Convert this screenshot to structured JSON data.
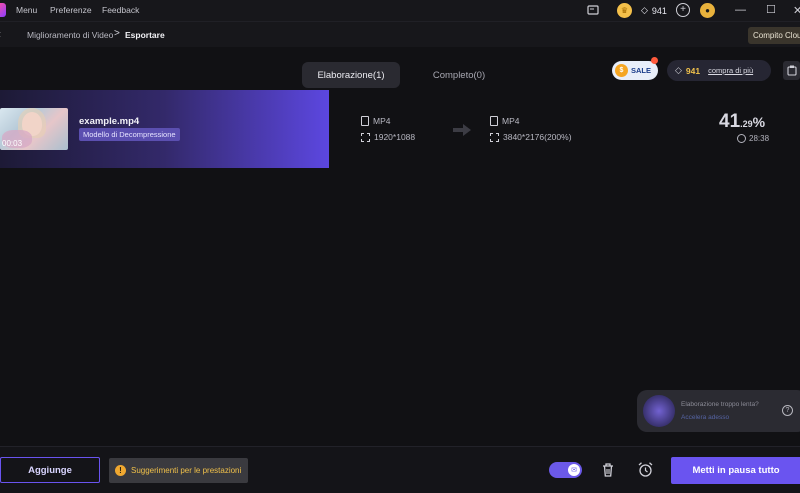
{
  "titlebar": {
    "menu": [
      "Menu",
      "Preferenze",
      "Feedback"
    ],
    "credits": "941"
  },
  "breadcrumb": {
    "parent": "Miglioramento di Video",
    "separator": ">",
    "current": "Esportare",
    "task_button": "Compito Cloud"
  },
  "tabs": [
    {
      "label": "Elaborazione(1)",
      "active": true
    },
    {
      "label": "Completo(0)",
      "active": false
    }
  ],
  "promo": {
    "sale_label": "SALE",
    "credits": "941",
    "buy_label": "compra di più"
  },
  "task": {
    "file_name": "example.mp4",
    "thumb_time": "00:03",
    "model": "Modello di Decompressione",
    "source": {
      "format": "MP4",
      "resolution": "1920*1088"
    },
    "target": {
      "format": "MP4",
      "resolution": "3840*2176(200%)"
    },
    "progress": {
      "whole": "41",
      "fraction": ".29",
      "sign": "%",
      "value_percent": 41.29
    },
    "eta": "28:38"
  },
  "toast": {
    "line1": "Elaborazione troppo lenta?",
    "line2": "Accelera adesso"
  },
  "bottom": {
    "add_label": "Aggiunge",
    "tips_label": "Suggerimenti per le prestazioni",
    "pause_label": "Metti in pausa tutto"
  },
  "colors": {
    "accent": "#6a54f0",
    "warning": "#f0c04a",
    "credits_gold": "#f0c14b"
  }
}
